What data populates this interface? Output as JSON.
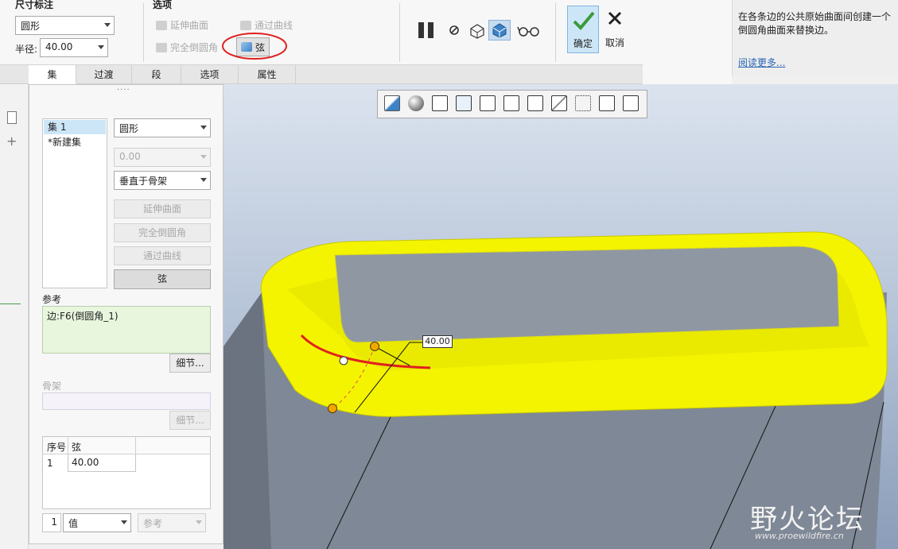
{
  "ribbon": {
    "dimension_group": {
      "title": "尺寸标注",
      "shape_value": "圆形",
      "radius_label": "半径:",
      "radius_value": "40.00"
    },
    "options_group": {
      "title": "选项",
      "extend_surface": "延伸曲面",
      "through_curve": "通过曲线",
      "full_round": "完全倒圆角",
      "chord": "弦"
    },
    "actions": {
      "ok": "确定",
      "cancel": "取消"
    }
  },
  "help": {
    "text": "在各条边的公共原始曲面间创建一个倒圆角曲面来替换边。",
    "link": "阅读更多..."
  },
  "tabs": [
    {
      "label": "集"
    },
    {
      "label": "过渡"
    },
    {
      "label": "段"
    },
    {
      "label": "选项"
    },
    {
      "label": "属性"
    }
  ],
  "panel": {
    "grip": "....",
    "sets": [
      "集 1",
      "*新建集"
    ],
    "shape_select": "圆形",
    "value_input": "0.00",
    "spine_select": "垂直于骨架",
    "btn_extend": "延伸曲面",
    "btn_full_round": "完全倒圆角",
    "btn_through_curve": "通过曲线",
    "btn_chord": "弦",
    "references_label": "参考",
    "references_value": "边:F6(倒圆角_1)",
    "details_label": "细节...",
    "spine_label": "骨架",
    "spine_details_label": "细节...",
    "table": {
      "headers": [
        "序号",
        "弦"
      ],
      "rows": [
        [
          "1",
          "40.00"
        ]
      ]
    },
    "bottom": {
      "index": "1",
      "value_select": "值",
      "ref_select": "参考"
    }
  },
  "viewport": {
    "dimension_label": "40.00"
  },
  "watermark": {
    "text": "野火论坛",
    "url": "www.proewildfire.cn"
  },
  "colors": {
    "accent_blue": "#3c82c8",
    "highlight_yellow": "#f4f400",
    "ok_bg": "#cde6f7",
    "annotation_red": "#e02020"
  }
}
